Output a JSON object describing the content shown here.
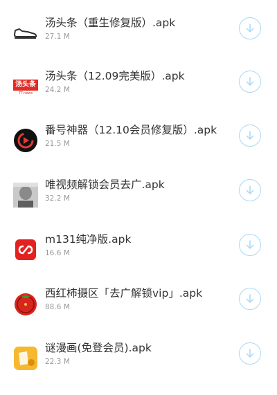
{
  "files": [
    {
      "name": "汤头条（重生修复版）.apk",
      "size": "27.1 M",
      "icon": "shoe-icon"
    },
    {
      "name": "汤头条（12.09完美版）.apk",
      "size": "24.2 M",
      "icon": "tangtoutiao-logo-icon",
      "logo_text": "汤头条",
      "logo_sub": "TT.news"
    },
    {
      "name": "番号神器（12.10会员修复版）.apk",
      "size": "21.5 M",
      "icon": "play-disc-icon"
    },
    {
      "name": "唯视频解锁会员去广.apk",
      "size": "32.2 M",
      "icon": "avatar-photo-icon"
    },
    {
      "name": "m131纯净版.apk",
      "size": "16.6 M",
      "icon": "red-cs-logo-icon"
    },
    {
      "name": "西红柿摄区「去广解锁vip」.apk",
      "size": "88.6 M",
      "icon": "tomato-icon"
    },
    {
      "name": "谜漫画(免登会员).apk",
      "size": "22.3 M",
      "icon": "yellow-comic-icon"
    }
  ],
  "download_icon": "download-arrow-icon"
}
